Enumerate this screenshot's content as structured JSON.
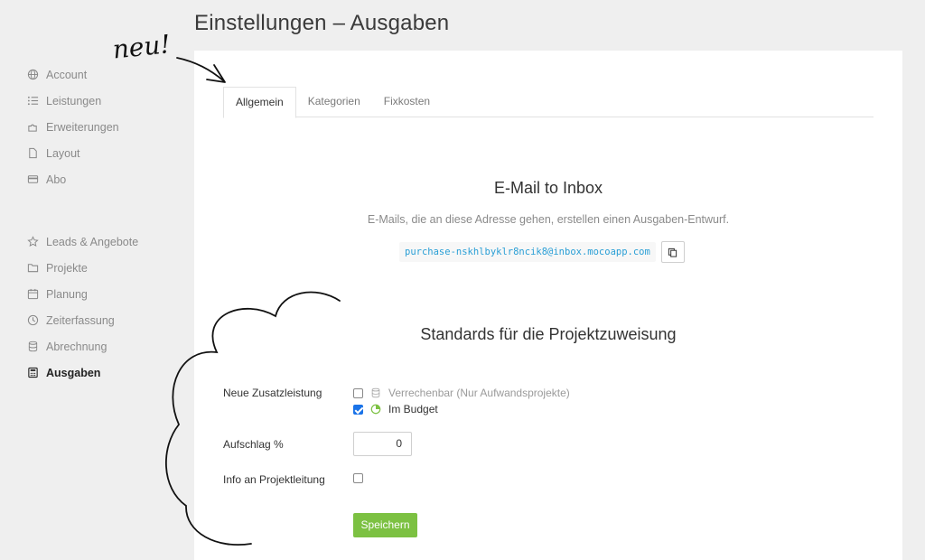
{
  "page": {
    "title": "Einstellungen – Ausgaben",
    "annotation": "neu!"
  },
  "sidebar": {
    "group1": [
      {
        "label": "Account",
        "icon": "globe-icon"
      },
      {
        "label": "Leistungen",
        "icon": "list-icon"
      },
      {
        "label": "Erweiterungen",
        "icon": "puzzle-icon"
      },
      {
        "label": "Layout",
        "icon": "document-icon"
      },
      {
        "label": "Abo",
        "icon": "credit-card-icon"
      }
    ],
    "group2": [
      {
        "label": "Leads & Angebote",
        "icon": "star-icon"
      },
      {
        "label": "Projekte",
        "icon": "folder-icon"
      },
      {
        "label": "Planung",
        "icon": "calendar-icon"
      },
      {
        "label": "Zeiterfassung",
        "icon": "clock-icon"
      },
      {
        "label": "Abrechnung",
        "icon": "database-icon"
      },
      {
        "label": "Ausgaben",
        "icon": "calculator-icon",
        "active": true
      }
    ]
  },
  "tabs": [
    {
      "label": "Allgemein",
      "active": true
    },
    {
      "label": "Kategorien",
      "active": false
    },
    {
      "label": "Fixkosten",
      "active": false
    }
  ],
  "email_section": {
    "title": "E-Mail to Inbox",
    "description": "E-Mails, die an diese Adresse gehen, erstellen einen Ausgaben-Entwurf.",
    "address": "purchase-nskhlbyklr8ncik8@inbox.mocoapp.com",
    "copy_icon": "copy-icon"
  },
  "standards_section": {
    "title": "Standards für die Projektzuweisung",
    "neue_zusatzleistung": {
      "label": "Neue Zusatzleistung",
      "options": [
        {
          "label": "Verrechenbar (Nur Aufwandsprojekte)",
          "checked": false,
          "icon": "database-icon"
        },
        {
          "label": "Im Budget",
          "checked": true,
          "icon": "pie-chart-icon"
        }
      ]
    },
    "aufschlag": {
      "label": "Aufschlag %",
      "value": "0"
    },
    "info_projektleitung": {
      "label": "Info an Projektleitung",
      "checked": false
    },
    "save_label": "Speichern"
  },
  "colors": {
    "accent_green": "#7cc142",
    "link_blue": "#2a9fd6",
    "checkbox_blue": "#1a73e8",
    "background": "#efefef"
  }
}
